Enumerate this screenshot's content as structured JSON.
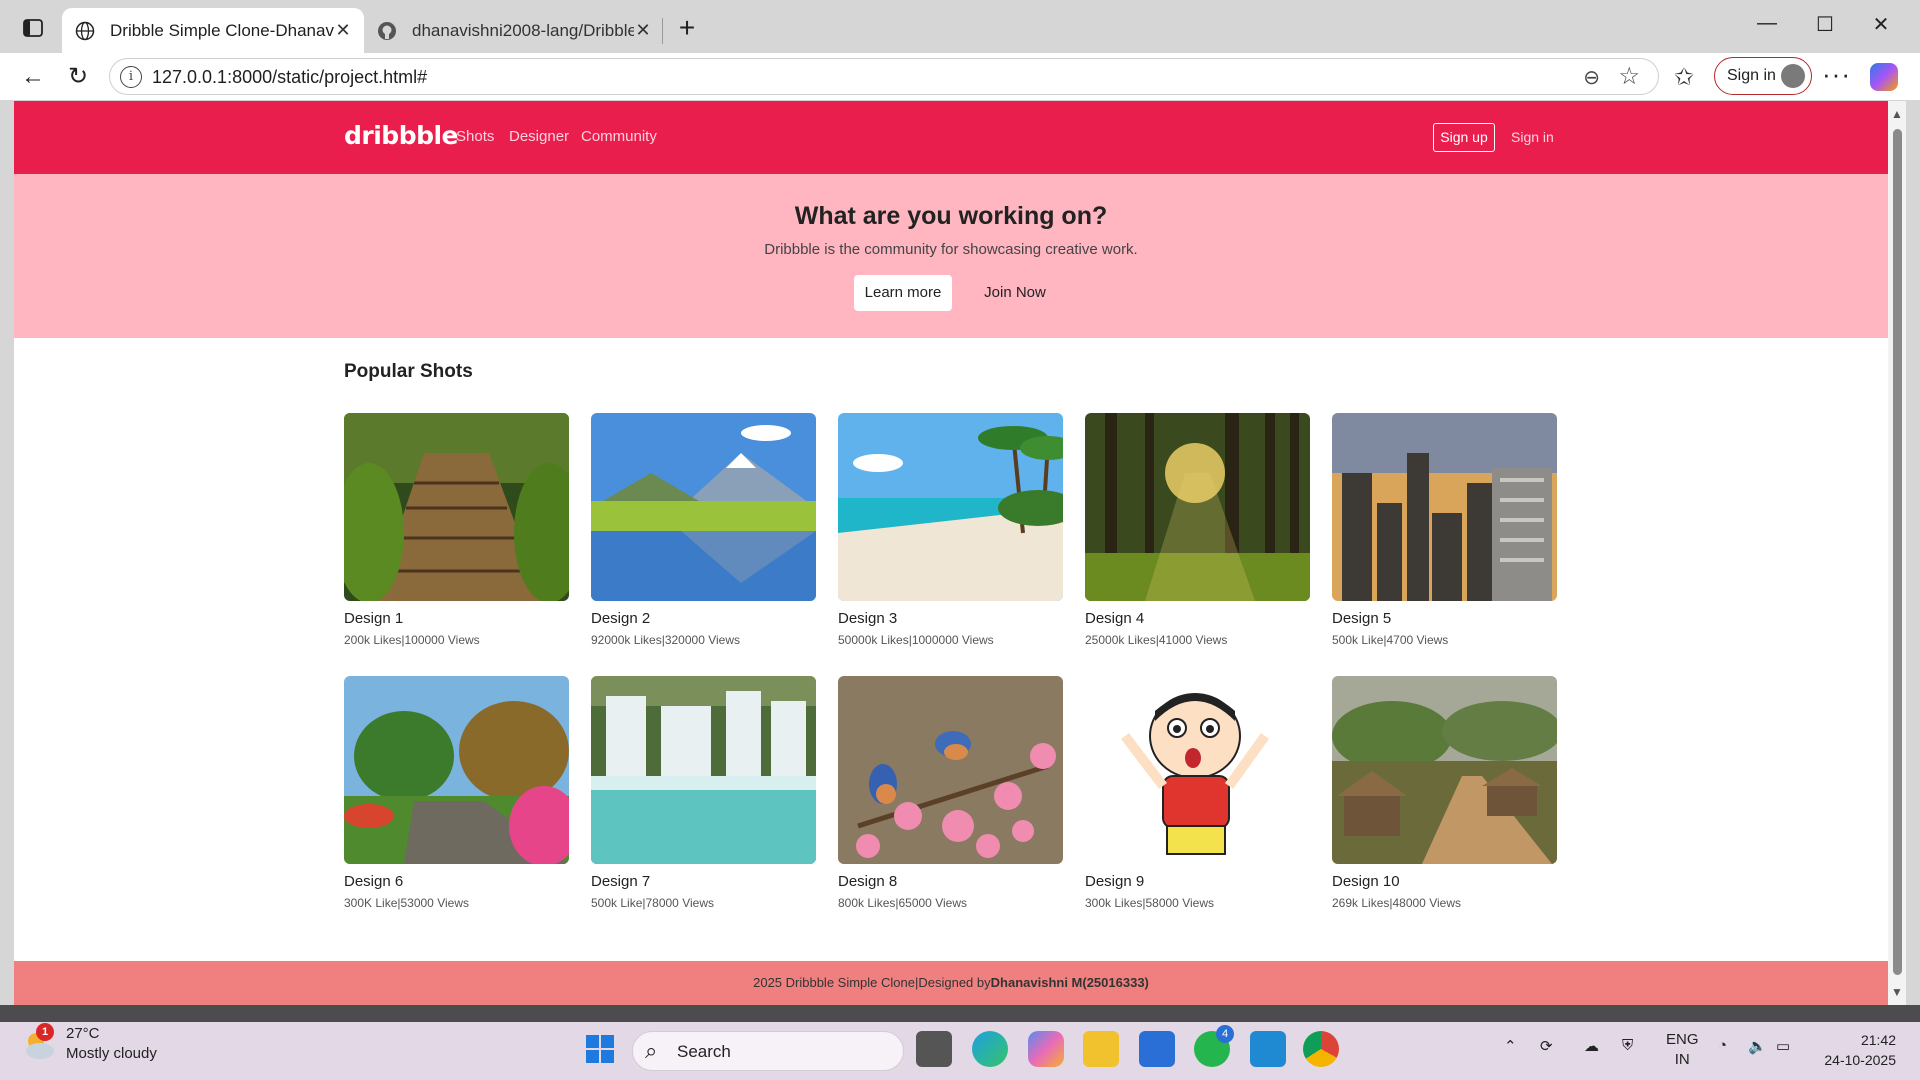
{
  "browser": {
    "tabs": [
      {
        "title": "Dribble Simple Clone-Dhanavishni",
        "active": true
      },
      {
        "title": "dhanavishni2008-lang/Dribble",
        "active": false
      }
    ],
    "url": "127.0.0.1:8000/static/project.html#",
    "signin_label": "Sign in"
  },
  "site": {
    "logo": "dribbble",
    "nav": [
      "Shots",
      "Designer",
      "Community"
    ],
    "signup_label": "Sign up",
    "signin_label": "Sign in",
    "hero": {
      "title": "What are you working on?",
      "subtitle": "Dribbble is the community for showcasing creative work.",
      "learn_more": "Learn more",
      "join_now": "Join Now"
    },
    "section_title": "Popular Shots",
    "cards": [
      {
        "title": "Design 1",
        "stats": "200k Likes|100000 Views",
        "image": "mossy wooden walkway in forest"
      },
      {
        "title": "Design 2",
        "stats": "92000k Likes|320000 Views",
        "image": "alpine lake with snowy mountains"
      },
      {
        "title": "Design 3",
        "stats": "50000k Likes|1000000 Views",
        "image": "tropical beach with palm trees"
      },
      {
        "title": "Design 4",
        "stats": "25000k Likes|41000 Views",
        "image": "sunlit pine forest"
      },
      {
        "title": "Design 5",
        "stats": "500k Like|4700 Views",
        "image": "city skyline at sunset"
      },
      {
        "title": "Design 6",
        "stats": "300K Like|53000 Views",
        "image": "garden path with flowers"
      },
      {
        "title": "Design 7",
        "stats": "500k Like|78000 Views",
        "image": "waterfall into turquoise pool"
      },
      {
        "title": "Design 8",
        "stats": "800k Likes|65000 Views",
        "image": "bluebirds on blossom branch"
      },
      {
        "title": "Design 9",
        "stats": "300k Likes|58000 Views",
        "image": "cartoon boy in red shirt"
      },
      {
        "title": "Design 10",
        "stats": "269k Likes|48000 Views",
        "image": "village huts and dirt road"
      }
    ],
    "footer": {
      "prefix": "2025 Dribbble Simple Clone|Designed by",
      "author": "Dhanavishni M(25016333)"
    }
  },
  "taskbar": {
    "weather_temp": "27°C",
    "weather_desc": "Mostly cloudy",
    "weather_badge": "1",
    "search_label": "Search",
    "whatsapp_badge": "4",
    "lang_top": "ENG",
    "lang_bottom": "IN",
    "time": "21:42",
    "date": "24-10-2025"
  },
  "colors": {
    "header": "#ea1e4d",
    "hero": "#ffb6c1",
    "footer": "#f08080"
  }
}
